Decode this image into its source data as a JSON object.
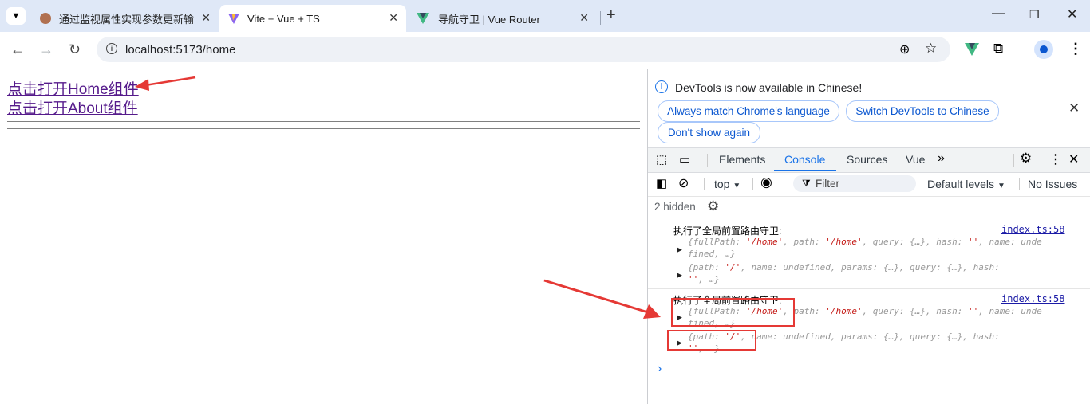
{
  "browser": {
    "tabs": [
      {
        "title": "通过监视属性实现参数更新输出"
      },
      {
        "title": "Vite + Vue + TS"
      },
      {
        "title": "导航守卫 | Vue Router"
      }
    ],
    "url": "localhost:5173/home"
  },
  "page": {
    "links": [
      "点击打开Home组件",
      "点击打开About组件"
    ]
  },
  "devtools": {
    "infobar": {
      "message": "DevTools is now available in Chinese!",
      "buttons": [
        "Always match Chrome's language",
        "Switch DevTools to Chinese",
        "Don't show again"
      ]
    },
    "tabs": [
      "Elements",
      "Console",
      "Sources",
      "Vue"
    ],
    "active_tab": "Console",
    "console_toolbar": {
      "context": "top",
      "filter_placeholder": "Filter",
      "levels": "Default levels",
      "issues": "No Issues"
    },
    "hidden_count": "2 hidden",
    "logs": [
      {
        "message": "执行了全局前置路由守卫:",
        "source": "index.ts:58",
        "to": {
          "line1_a": "{fullPath: ",
          "line1_b": "'/home'",
          "line1_c": ", path: ",
          "line1_d": "'/home'",
          "line1_e": ", query: {…}, hash: ",
          "line1_f": "''",
          "line1_g": ", name: unde",
          "line2": "fined, …}"
        },
        "from": {
          "line1_a": "{path: ",
          "line1_b": "'/'",
          "line1_c": ", name: undefined, params: {…}, query: {…}, hash:",
          "line2_a": "''",
          "line2_b": ", …}"
        }
      },
      {
        "message": "执行了全局前置路由守卫:",
        "source": "index.ts:58",
        "to": {
          "line1_a": "{fullPath: ",
          "line1_b": "'/home'",
          "line1_c": ", path: ",
          "line1_d": "'/home'",
          "line1_e": ", query: {…}, hash: ",
          "line1_f": "''",
          "line1_g": ", name: unde",
          "line2": "fined, …}"
        },
        "from": {
          "line1_a": "{path: ",
          "line1_b": "'/'",
          "line1_c": ", name: undefined, params: {…}, query: {…}, hash:",
          "line2_a": "''",
          "line2_b": ", …}"
        }
      }
    ],
    "prompt": "›"
  },
  "colors": {
    "accent": "#1a73e8",
    "annotation": "#e53935"
  }
}
